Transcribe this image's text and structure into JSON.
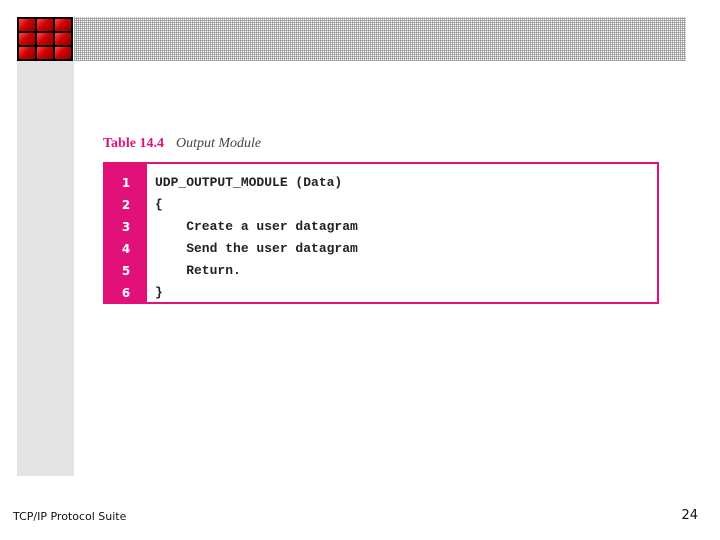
{
  "table": {
    "number": "Table 14.4",
    "title": "Output Module"
  },
  "code_lines": [
    {
      "num": "1",
      "text": "UDP_OUTPUT_MODULE (Data)"
    },
    {
      "num": "2",
      "text": "{"
    },
    {
      "num": "3",
      "text": "    Create a user datagram"
    },
    {
      "num": "4",
      "text": "    Send the user datagram"
    },
    {
      "num": "5",
      "text": "    Return."
    },
    {
      "num": "6",
      "text": "}"
    }
  ],
  "footer": {
    "left_text": "TCP/IP Protocol Suite",
    "page_number": "24"
  },
  "colors": {
    "accent": "#e2117a",
    "logo_red": "#d20000",
    "sidebar": "#e3e3e3"
  }
}
